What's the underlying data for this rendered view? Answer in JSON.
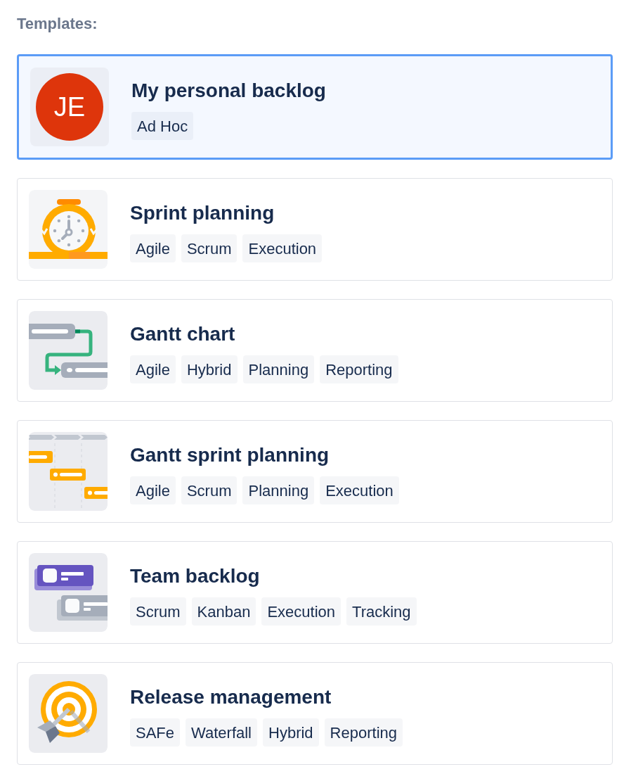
{
  "heading": "Templates:",
  "templates": [
    {
      "title": "My personal backlog",
      "selected": true,
      "thumbnail": {
        "kind": "avatar",
        "initials": "JE"
      },
      "tags": [
        "Ad Hoc"
      ]
    },
    {
      "title": "Sprint planning",
      "selected": false,
      "thumbnail": {
        "kind": "stopwatch"
      },
      "tags": [
        "Agile",
        "Scrum",
        "Execution"
      ]
    },
    {
      "title": "Gantt chart",
      "selected": false,
      "thumbnail": {
        "kind": "flowchart"
      },
      "tags": [
        "Agile",
        "Hybrid",
        "Planning",
        "Reporting"
      ]
    },
    {
      "title": "Gantt sprint planning",
      "selected": false,
      "thumbnail": {
        "kind": "timeline"
      },
      "tags": [
        "Agile",
        "Scrum",
        "Planning",
        "Execution"
      ]
    },
    {
      "title": "Team backlog",
      "selected": false,
      "thumbnail": {
        "kind": "cards"
      },
      "tags": [
        "Scrum",
        "Kanban",
        "Execution",
        "Tracking"
      ]
    },
    {
      "title": "Release management",
      "selected": false,
      "thumbnail": {
        "kind": "target"
      },
      "tags": [
        "SAFe",
        "Waterfall",
        "Hybrid",
        "Reporting"
      ]
    }
  ]
}
